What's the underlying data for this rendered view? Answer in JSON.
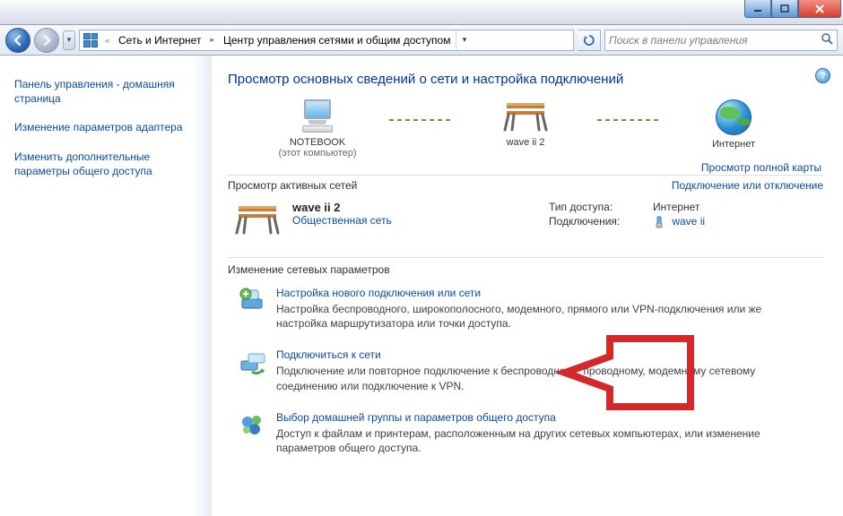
{
  "breadcrumb": {
    "seg1": "Сеть и Интернет",
    "seg2": "Центр управления сетями и общим доступом"
  },
  "search": {
    "placeholder": "Поиск в панели управления"
  },
  "sidebar": {
    "items": [
      "Панель управления - домашняя страница",
      "Изменение параметров адаптера",
      "Изменить дополнительные параметры общего доступа"
    ]
  },
  "page_title": "Просмотр основных сведений о сети и настройка подключений",
  "full_map": "Просмотр полной карты",
  "map": {
    "node1": {
      "label": "NOTEBOOK",
      "sub": "(этот компьютер)"
    },
    "node2": {
      "label": "wave ii  2"
    },
    "node3": {
      "label": "Интернет"
    }
  },
  "active_header": {
    "title": "Просмотр активных сетей",
    "right": "Подключение или отключение"
  },
  "active_net": {
    "name": "wave ii  2",
    "kind": "Общественная сеть",
    "props": {
      "k1": "Тип доступа:",
      "v1": "Интернет",
      "k2": "Подключения:",
      "v2": "wave ii"
    }
  },
  "param_section": "Изменение сетевых параметров",
  "tasks": [
    {
      "title": "Настройка нового подключения или сети",
      "desc": "Настройка беспроводного, широкополосного, модемного, прямого или VPN-подключения или же настройка маршрутизатора или точки доступа."
    },
    {
      "title": "Подключиться к сети",
      "desc": "Подключение или повторное подключение к беспроводному, проводному, модемному сетевому соединению или подключение к VPN."
    },
    {
      "title": "Выбор домашней группы и параметров общего доступа",
      "desc": "Доступ к файлам и принтерам, расположенным на других сетевых компьютерах, или изменение параметров общего доступа."
    }
  ]
}
